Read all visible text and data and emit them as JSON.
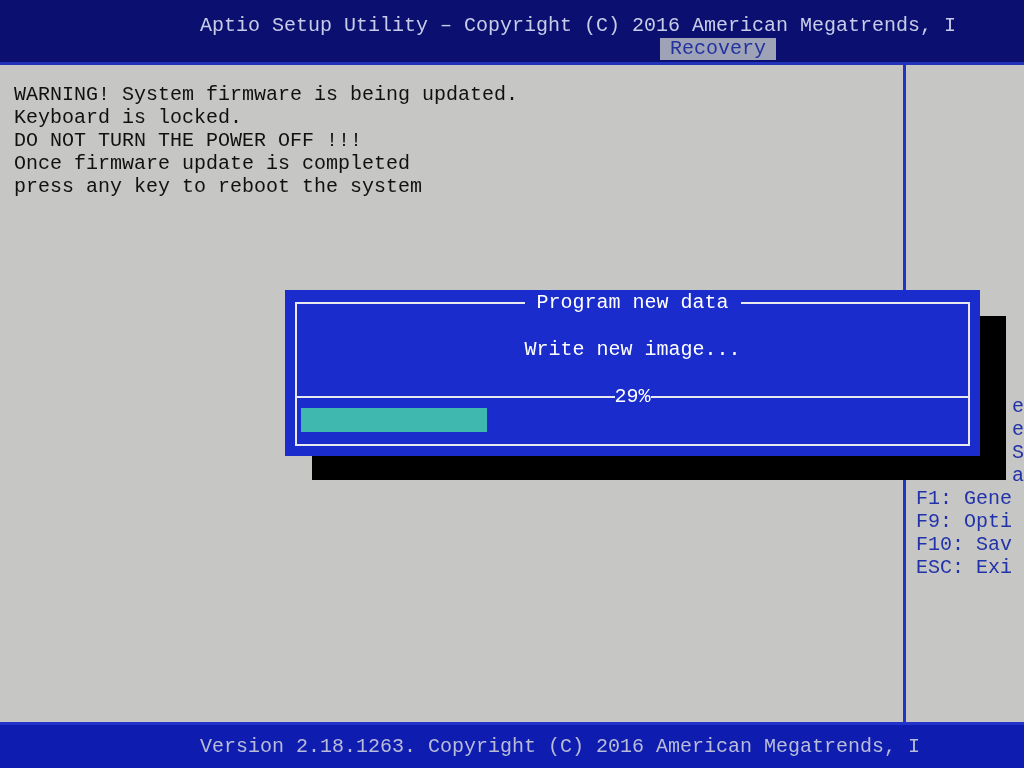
{
  "header": {
    "title": "Aptio Setup Utility – Copyright (C) 2016 American Megatrends, I",
    "tabs": [
      {
        "label": "Recovery",
        "selected": true
      }
    ]
  },
  "messages": [
    "WARNING! System firmware is being updated.",
    "Keyboard is locked.",
    "DO NOT TURN THE POWER OFF !!!",
    "Once firmware update is completed",
    "press any key to reboot the system"
  ],
  "help_panel": {
    "hidden_lines": [
      "e",
      "e",
      "S",
      "a"
    ],
    "keys": [
      "F1: Gene",
      "F9: Opti",
      "F10: Sav",
      "ESC: Exi"
    ]
  },
  "dialog": {
    "title": "Program new data",
    "message": "Write new image...",
    "reading": "29%",
    "level": 0.28
  },
  "footer": {
    "text": "Version 2.18.1263. Copyright (C) 2016 American Megatrends, I"
  }
}
